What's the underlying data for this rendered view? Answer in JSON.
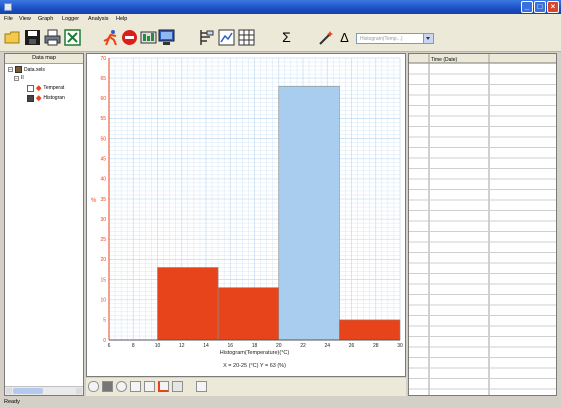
{
  "window": {
    "title": ""
  },
  "menu": [
    "File",
    "View",
    "Graph",
    "Logger",
    "Analysis",
    "Help"
  ],
  "toolbar": {
    "icons": [
      "open-folder-icon",
      "save-icon",
      "print-icon",
      "export-excel-icon",
      "run-icon",
      "stop-icon",
      "meter-icon",
      "monitor-icon",
      "table-view-icon",
      "graph-view-icon",
      "grid-view-icon",
      "sigma-icon",
      "wand-icon",
      "delta-icon"
    ],
    "sigma": "Σ",
    "delta": "Δ",
    "combo_value": "Histogram(Temp...)"
  },
  "data_map": {
    "header": "Data map",
    "root": "Data.xels",
    "node": "II",
    "items": [
      "Temperat",
      "Histogran"
    ]
  },
  "chart_data": {
    "type": "bar",
    "bins": [
      {
        "from": 10,
        "to": 15,
        "value": 18,
        "color": "#e8441c"
      },
      {
        "from": 15,
        "to": 20,
        "value": 13,
        "color": "#e8441c"
      },
      {
        "from": 20,
        "to": 25,
        "value": 63,
        "color": "#a8cdef"
      },
      {
        "from": 25,
        "to": 30,
        "value": 5,
        "color": "#e8441c"
      }
    ],
    "xlim": [
      6,
      30
    ],
    "ylim": [
      0,
      70
    ],
    "xticks": [
      "6",
      "8",
      "10",
      "12",
      "14",
      "16",
      "18",
      "20",
      "22",
      "24",
      "26",
      "28",
      "30"
    ],
    "yticks": [
      "0",
      "5",
      "10",
      "15",
      "20",
      "25",
      "30",
      "35",
      "40",
      "45",
      "50",
      "55",
      "60",
      "65",
      "70"
    ],
    "xlabel": "Histogram(Temperature)(°C)",
    "ylabel": "%",
    "readout": "X = 20-25 (°C) Y = 63 (%)",
    "grid": true,
    "gridColor": "#c9dff3",
    "axisLabelColor": "#e8441c"
  },
  "table": {
    "columns": [
      "Time (Date)",
      ""
    ]
  },
  "graph_toolbar": {
    "icons": [
      "chat-icon",
      "camera-icon",
      "zoom-icon",
      "zoom-fit-icon",
      "zoom-out-icon",
      "axes-icon",
      "cursor-icon",
      "hand-icon"
    ]
  },
  "status": "Ready"
}
